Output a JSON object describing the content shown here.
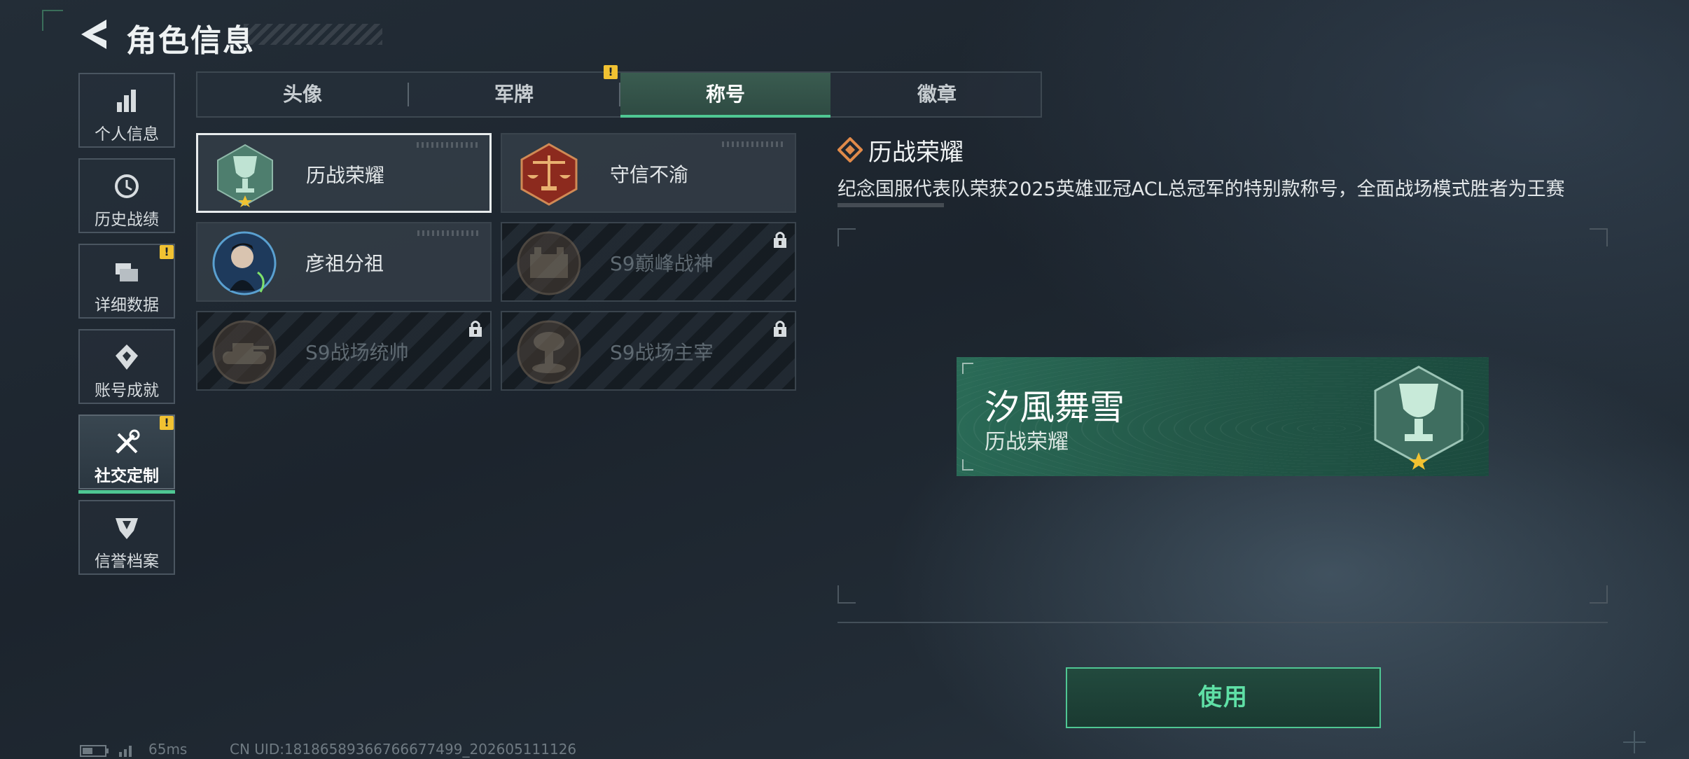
{
  "header": {
    "title": "角色信息"
  },
  "sidebar": {
    "items": [
      {
        "label": "个人信息",
        "icon": "bar-chart-icon",
        "warn": false
      },
      {
        "label": "历史战绩",
        "icon": "history-clock-icon",
        "warn": false
      },
      {
        "label": "详细数据",
        "icon": "folder-data-icon",
        "warn": true
      },
      {
        "label": "账号成就",
        "icon": "achievement-icon",
        "warn": false
      },
      {
        "label": "社交定制",
        "icon": "wrench-tools-icon",
        "warn": true,
        "active": true
      },
      {
        "label": "信誉档案",
        "icon": "credit-shield-icon",
        "warn": false
      }
    ]
  },
  "tabs": [
    {
      "label": "头像",
      "warn": false
    },
    {
      "label": "军牌",
      "warn": true
    },
    {
      "label": "称号",
      "active": true,
      "warn": false
    },
    {
      "label": "徽章",
      "warn": false
    }
  ],
  "titles": [
    {
      "label": "历战荣耀",
      "emblem": "trophy-emblem-icon",
      "selected": true,
      "locked": false
    },
    {
      "label": "守信不渝",
      "emblem": "scales-emblem-icon",
      "selected": false,
      "locked": false
    },
    {
      "label": "彦祖分祖",
      "emblem": "portrait-emblem-icon",
      "selected": false,
      "locked": false
    },
    {
      "label": "S9巅峰战神",
      "emblem": "fortress-emblem-icon",
      "selected": false,
      "locked": true
    },
    {
      "label": "S9战场统帅",
      "emblem": "tank-emblem-icon",
      "selected": false,
      "locked": true
    },
    {
      "label": "S9战场主宰",
      "emblem": "explosion-emblem-icon",
      "selected": false,
      "locked": true
    }
  ],
  "detail": {
    "title": "历战荣耀",
    "description": "纪念国服代表队荣获2025英雄亚冠ACL总冠军的特别款称号，全面战场模式胜者为王赛",
    "preview": {
      "name": "汐風舞雪",
      "subtitle": "历战荣耀"
    }
  },
  "actions": {
    "use_label": "使用"
  },
  "status_bar": {
    "ping": "65ms",
    "uid": "CN UID:18186589366766677499_202605111126"
  },
  "colors": {
    "accent": "#4fc793",
    "warning": "#f1c232",
    "banner": "#235848"
  }
}
